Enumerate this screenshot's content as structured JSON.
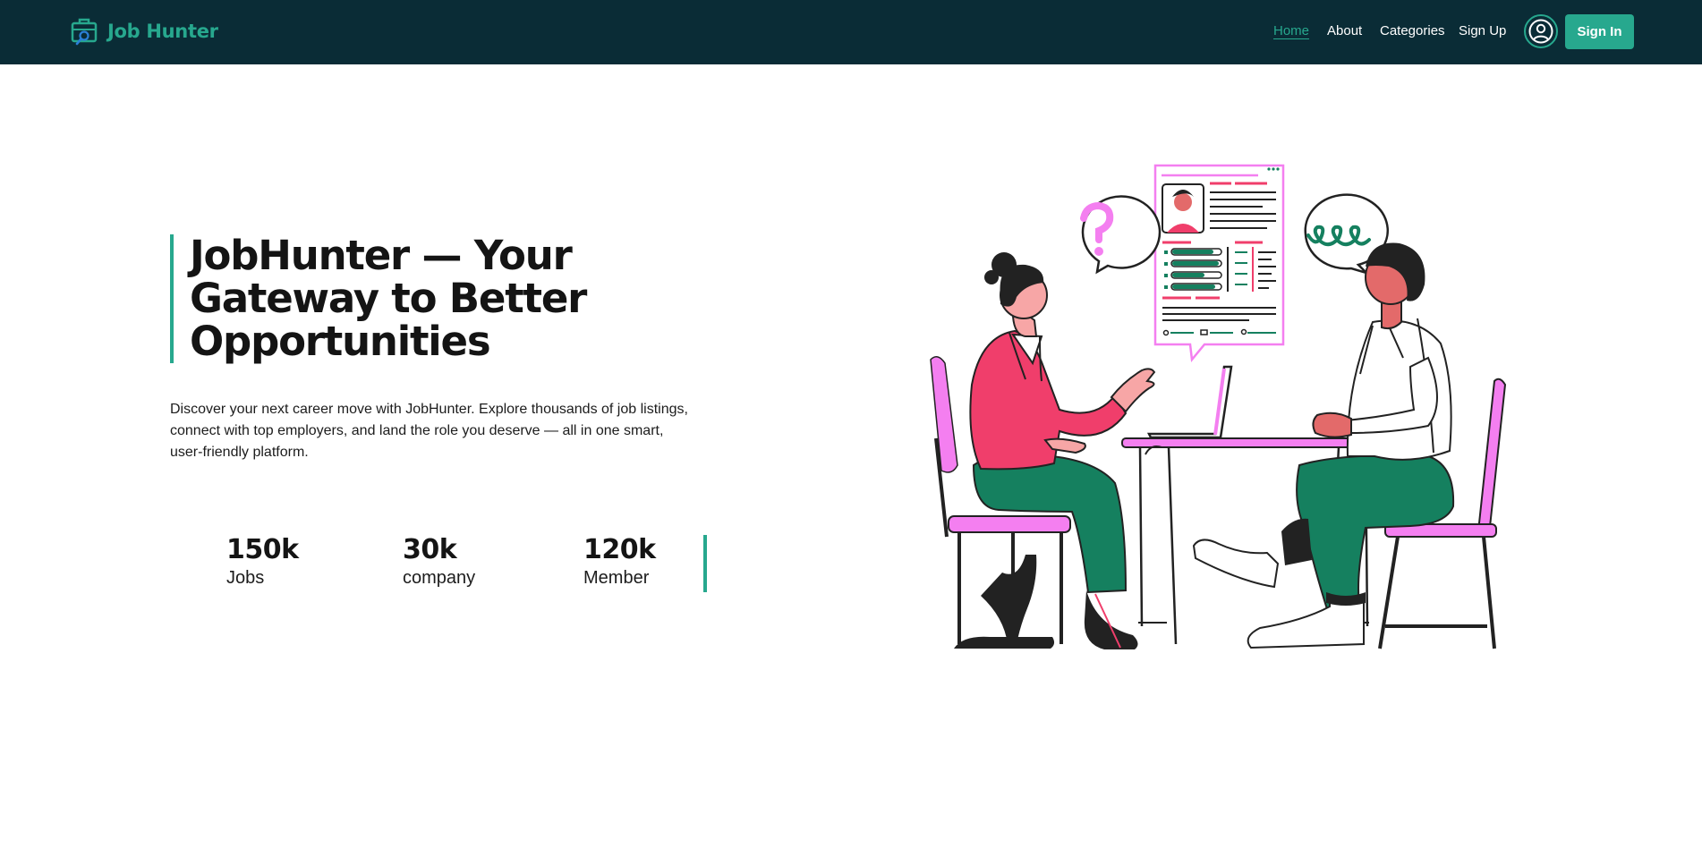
{
  "header": {
    "brand": "Job Hunter",
    "nav": [
      {
        "label": "Home",
        "active": true
      },
      {
        "label": "About",
        "active": false
      },
      {
        "label": "Categories",
        "active": false
      },
      {
        "label": "Sign Up",
        "active": false
      }
    ],
    "user_icon": "user-circle-icon",
    "signin_label": "Sign In"
  },
  "hero": {
    "title": "JobHunter — Your Gateway to Better Opportunities",
    "description": "Discover your next career move with JobHunter. Explore thousands of job listings, connect with top employers, and land the role you deserve — all in one smart, user-friendly platform.",
    "stats": [
      {
        "value": "150k",
        "label": "Jobs"
      },
      {
        "value": "30k",
        "label": "company"
      },
      {
        "value": "120k",
        "label": "Member"
      }
    ]
  },
  "colors": {
    "header_bg": "#0a2c36",
    "accent": "#27a88e",
    "pink": "#f03e6b",
    "magenta": "#f47ff0",
    "green_pants": "#15805f"
  }
}
